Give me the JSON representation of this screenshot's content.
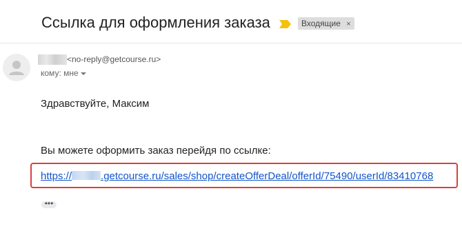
{
  "email": {
    "subject": "Ссылка для оформления заказа",
    "label": "Входящие",
    "label_remove": "×",
    "sender": {
      "email": "<no-reply@getcourse.ru>"
    },
    "recipient": "кому: мне",
    "body": {
      "greeting": "Здравствуйте, Максим",
      "instruction": "Вы можете оформить заказ перейдя по ссылке:",
      "link_prefix": "https://",
      "link_suffix": ".getcourse.ru/sales/shop/createOfferDeal/offerId/75490/userId/83410768"
    },
    "show_trimmed": "•••"
  },
  "colors": {
    "important_marker": "#f4c20d",
    "link": "#1155cc",
    "highlight_box": "#d9403a",
    "label_chip": "#dddddd"
  },
  "icons": {
    "important": "important-marker-icon",
    "avatar": "person-icon",
    "recipient_details": "caret-down-icon"
  }
}
